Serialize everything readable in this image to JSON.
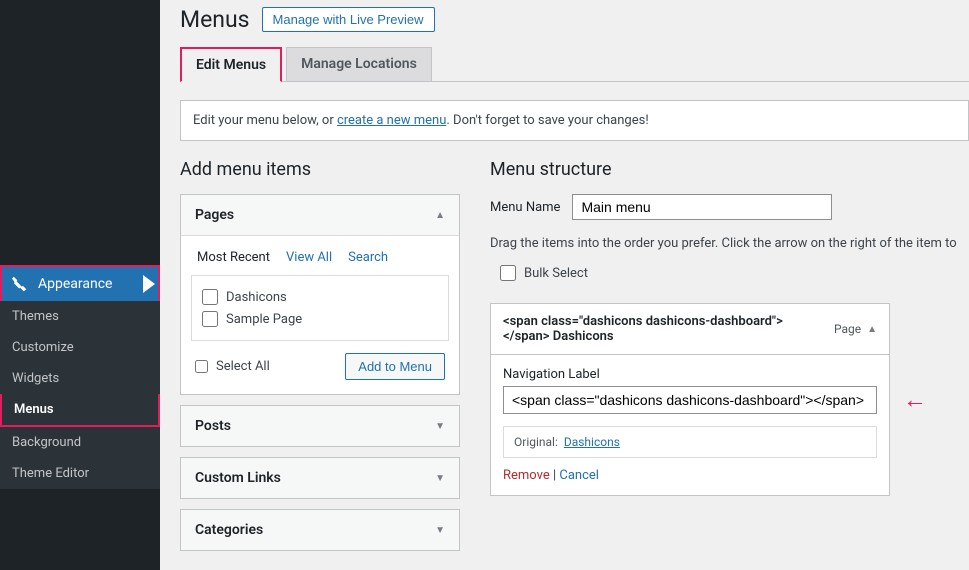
{
  "sidebar": {
    "parent_label": "Appearance",
    "items": [
      {
        "label": "Themes"
      },
      {
        "label": "Customize"
      },
      {
        "label": "Widgets"
      },
      {
        "label": "Menus",
        "active": true
      },
      {
        "label": "Background"
      },
      {
        "label": "Theme Editor"
      }
    ]
  },
  "page": {
    "title": "Menus",
    "live_preview_btn": "Manage with Live Preview"
  },
  "tabs": {
    "edit_menus": "Edit Menus",
    "manage_locations": "Manage Locations"
  },
  "notice": {
    "prefix": "Edit your menu below, or ",
    "link": "create a new menu",
    "suffix": ". Don't forget to save your changes!"
  },
  "left": {
    "heading": "Add menu items",
    "pages": {
      "title": "Pages",
      "subtabs": {
        "most_recent": "Most Recent",
        "view_all": "View All",
        "search": "Search"
      },
      "items": [
        {
          "label": "Dashicons"
        },
        {
          "label": "Sample Page"
        }
      ],
      "select_all": "Select All",
      "add_btn": "Add to Menu"
    },
    "posts": "Posts",
    "custom_links": "Custom Links",
    "categories": "Categories"
  },
  "right": {
    "heading": "Menu structure",
    "menu_name_label": "Menu Name",
    "menu_name_value": "Main menu",
    "drag_hint": "Drag the items into the order you prefer. Click the arrow on the right of the item to",
    "bulk_select": "Bulk Select",
    "item": {
      "title": "<span class=\"dashicons dashicons-dashboard\"></span> Dashicons",
      "type": "Page",
      "nav_label_label": "Navigation Label",
      "nav_label_value": "<span class=\"dashicons dashicons-dashboard\"></span> Da",
      "original_label": "Original:",
      "original_link": "Dashicons",
      "remove": "Remove",
      "cancel": "Cancel"
    }
  }
}
